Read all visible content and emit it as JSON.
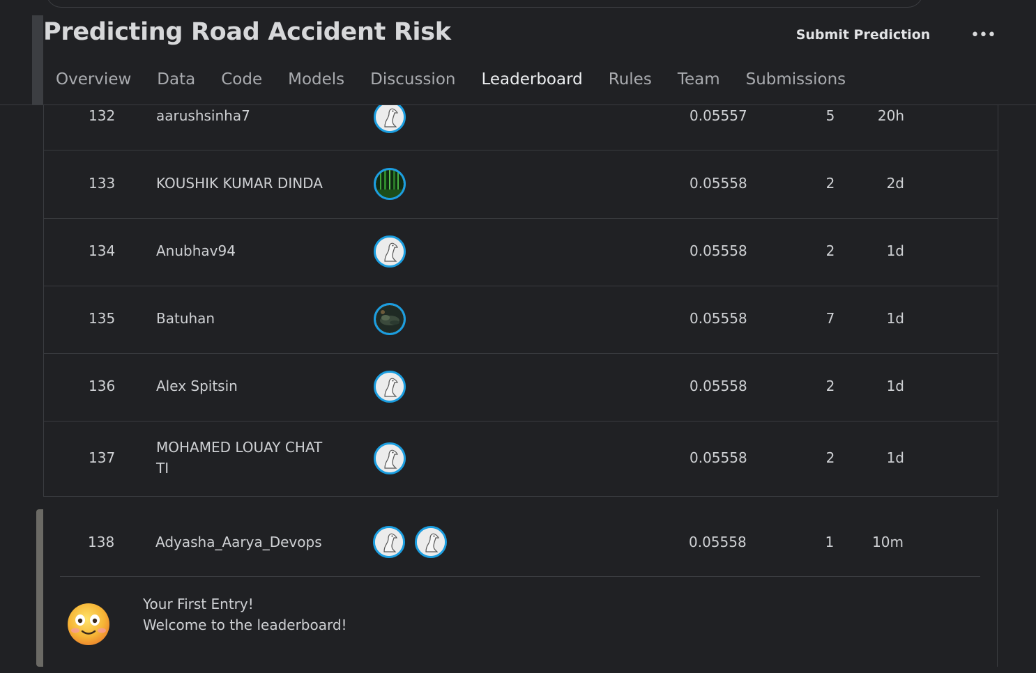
{
  "header": {
    "title": "Predicting Road Accident Risk",
    "submit_label": "Submit Prediction",
    "more_label": "•••"
  },
  "tabs": [
    {
      "label": "Overview"
    },
    {
      "label": "Data"
    },
    {
      "label": "Code"
    },
    {
      "label": "Models"
    },
    {
      "label": "Discussion"
    },
    {
      "label": "Leaderboard",
      "active": true
    },
    {
      "label": "Rules"
    },
    {
      "label": "Team"
    },
    {
      "label": "Submissions"
    }
  ],
  "rows": [
    {
      "rank": "132",
      "name": "aarushsinha7",
      "avatar": "goose-icon",
      "score": "0.05557",
      "entries": "5",
      "last": "20h"
    },
    {
      "rank": "133",
      "name": "KOUSHIK KUMAR DINDA",
      "avatar": "forest-photo-icon",
      "score": "0.05558",
      "entries": "2",
      "last": "2d"
    },
    {
      "rank": "134",
      "name": "Anubhav94",
      "avatar": "goose-icon",
      "score": "0.05558",
      "entries": "2",
      "last": "1d"
    },
    {
      "rank": "135",
      "name": "Batuhan",
      "avatar": "dark-photo-icon",
      "score": "0.05558",
      "entries": "7",
      "last": "1d"
    },
    {
      "rank": "136",
      "name": "Alex Spitsin",
      "avatar": "goose-icon",
      "score": "0.05558",
      "entries": "2",
      "last": "1d"
    },
    {
      "rank": "137",
      "name_line1": "MOHAMED LOUAY CHAT",
      "name_line2": "TI",
      "avatar": "goose-icon",
      "score": "0.05558",
      "entries": "2",
      "last": "1d"
    }
  ],
  "own_entry": {
    "rank": "138",
    "name": "Adyasha_Aarya_Devops",
    "score": "0.05558",
    "entries": "1",
    "last": "10m",
    "message_title": "Your First Entry!",
    "message_subtitle": "Welcome to the leaderboard!"
  },
  "colors": {
    "background": "#202124",
    "border": "#3a3c40",
    "avatar_ring": "#1b9ee0",
    "own_accent": "#6b6a65"
  }
}
